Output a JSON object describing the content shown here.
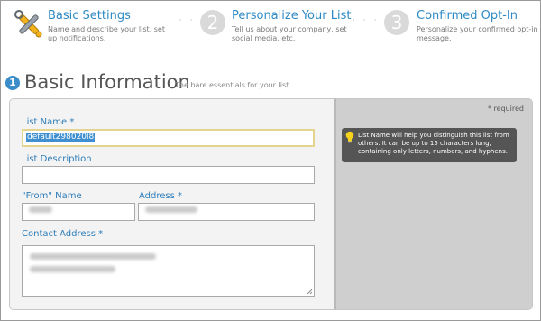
{
  "steps": [
    {
      "number": "1",
      "title": "Basic Settings",
      "desc": "Name and describe your list, set up notifications."
    },
    {
      "number": "2",
      "title": "Personalize Your List",
      "desc": "Tell us about your company, set social media, etc."
    },
    {
      "number": "3",
      "title": "Confirmed Opt-In",
      "desc": "Personalize your confirmed opt-in message."
    }
  ],
  "step_separator": "· · ·",
  "section": {
    "badge": "1",
    "title": "Basic Information",
    "subtitle": "The bare essentials for your list."
  },
  "required_note": "* required",
  "tip": {
    "icon": "lightbulb-icon",
    "text": "List Name will help you distinguish this list from others. It can be up to 15 characters long, containing only letters, numbers, and hyphens."
  },
  "form": {
    "list_name_label": "List Name *",
    "list_name_value": "default298020l8",
    "list_description_label": "List Description",
    "list_description_value": "",
    "from_name_label": "\"From\" Name",
    "address_label": "Address *",
    "contact_address_label": "Contact Address *"
  },
  "colors": {
    "accent": "#2e8ac4",
    "tip_bg": "#555555",
    "focus_border": "#e5d48f"
  }
}
